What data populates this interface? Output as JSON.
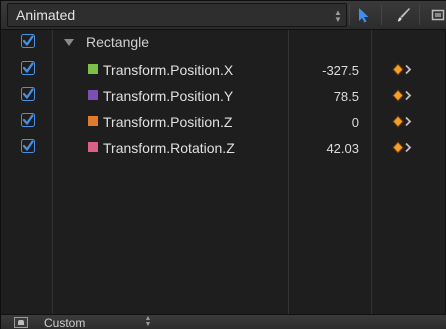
{
  "header": {
    "title": "Animated",
    "tools": [
      "arrow-select-icon",
      "paint-brush-icon",
      "frame-box-icon"
    ]
  },
  "group": {
    "label": "Rectangle",
    "enabled": true
  },
  "parameters": [
    {
      "label": "Transform.Position.X",
      "value": "-327.5",
      "color": "#7cc04a",
      "enabled": true
    },
    {
      "label": "Transform.Position.Y",
      "value": "78.5",
      "color": "#7b4fb6",
      "enabled": true
    },
    {
      "label": "Transform.Position.Z",
      "value": "0",
      "color": "#e07a2e",
      "enabled": true
    },
    {
      "label": "Transform.Rotation.Z",
      "value": "42.03",
      "color": "#dc5f86",
      "enabled": true
    }
  ],
  "footer": {
    "label": "Custom"
  },
  "colors": {
    "checkbox": "#4a90e2",
    "keyframe": "#f2a02a",
    "arrow_tool": "#3d8ef0"
  }
}
